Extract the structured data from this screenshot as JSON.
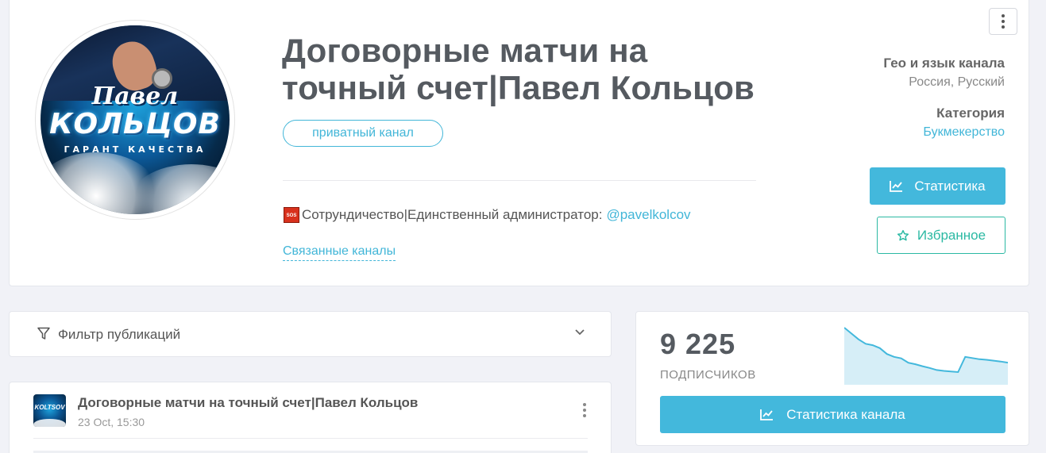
{
  "channel": {
    "title": "Договорные матчи на точный счет|Павел Кольцов",
    "privacy_badge": "приватный канал",
    "description_text": "Сотрундичество|Единственный администратор:",
    "description_mention": "@pavelkolcov",
    "description_icon": "sos-icon",
    "related_link": "Связанные каналы",
    "avatar_text_line1": "Павел",
    "avatar_text_line2": "КОЛЬЦОВ",
    "avatar_text_line3": "ГАРАНТ КАЧЕСТВА"
  },
  "meta": {
    "geo_label": "Гео и язык канала",
    "geo_value": "Россия, Русский",
    "category_label": "Категория",
    "category_value": "Букмекерство"
  },
  "actions": {
    "stats_label": "Статистика",
    "favorite_label": "Избранное"
  },
  "filter": {
    "label": "Фильтр публикаций"
  },
  "post": {
    "channel_name": "Договорные матчи на точный счет|Павел Кольцов",
    "date": "23 Oct, 15:30"
  },
  "subscribers": {
    "count": "9 225",
    "label": "ПОДПИСЧИКОВ",
    "button_label": "Статистика канала",
    "trend": [
      9400,
      9380,
      9360,
      9345,
      9340,
      9330,
      9310,
      9300,
      9295,
      9280,
      9275,
      9268,
      9262,
      9255,
      9252,
      9250,
      9248,
      9300,
      9296,
      9292,
      9290,
      9287,
      9284,
      9280
    ]
  },
  "colors": {
    "accent": "#43b8dc",
    "favorite": "#2bb9a3",
    "title": "#555a60"
  }
}
